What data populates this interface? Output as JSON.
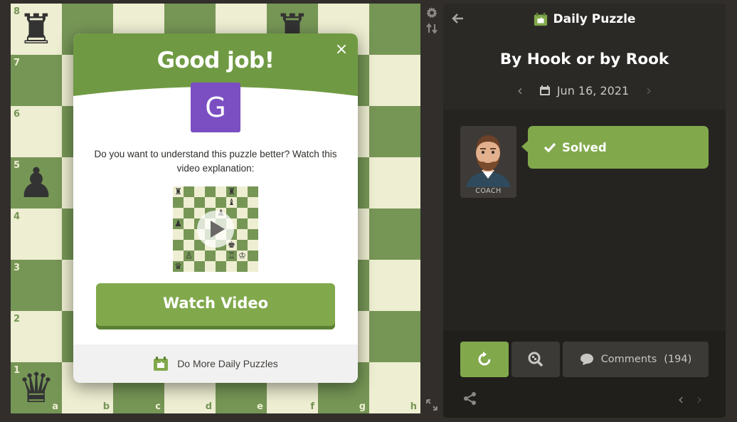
{
  "board": {
    "ranks": [
      "8",
      "7",
      "6",
      "5",
      "4",
      "3",
      "2",
      "1"
    ],
    "files": [
      "a",
      "b",
      "c",
      "d",
      "e",
      "f",
      "g",
      "h"
    ],
    "pieces": [
      {
        "square": "a8",
        "glyph": "♜",
        "name": "black-rook"
      },
      {
        "square": "f8",
        "glyph": "♜",
        "name": "black-rook"
      },
      {
        "square": "a5",
        "glyph": "♟",
        "name": "black-pawn"
      },
      {
        "square": "a1",
        "glyph": "♛",
        "name": "black-queen"
      }
    ],
    "colors": {
      "light": "#eeeed2",
      "dark": "#769656"
    }
  },
  "side_icons": {
    "settings": "gear-icon",
    "flip": "flip-board-icon",
    "expand": "expand-icon"
  },
  "modal": {
    "title": "Good job!",
    "close_glyph": "×",
    "avatar_letter": "G",
    "description": "Do you want to understand this puzzle better? Watch this video explanation:",
    "watch_button": "Watch Video",
    "footer_label": "Do More Daily Puzzles",
    "header_color": "#6f9a43",
    "mini_board_pieces": [
      {
        "r": 0,
        "c": 0,
        "g": "♜"
      },
      {
        "r": 0,
        "c": 5,
        "g": "♜"
      },
      {
        "r": 1,
        "c": 5,
        "g": "♝"
      },
      {
        "r": 2,
        "c": 4,
        "g": "♟"
      },
      {
        "r": 3,
        "c": 0,
        "g": "♟"
      },
      {
        "r": 5,
        "c": 5,
        "g": "♚"
      },
      {
        "r": 6,
        "c": 1,
        "g": "♙"
      },
      {
        "r": 6,
        "c": 5,
        "g": "♖"
      },
      {
        "r": 6,
        "c": 6,
        "g": "♔"
      },
      {
        "r": 7,
        "c": 0,
        "g": "♛"
      }
    ]
  },
  "panel": {
    "header": "Daily Puzzle",
    "puzzle_name": "By Hook or by Rook",
    "date": "Jun 16, 2021",
    "coach_label": "COACH",
    "status": "Solved",
    "comments_label": "Comments",
    "comments_count": "(194)",
    "accent": "#81a94c"
  }
}
